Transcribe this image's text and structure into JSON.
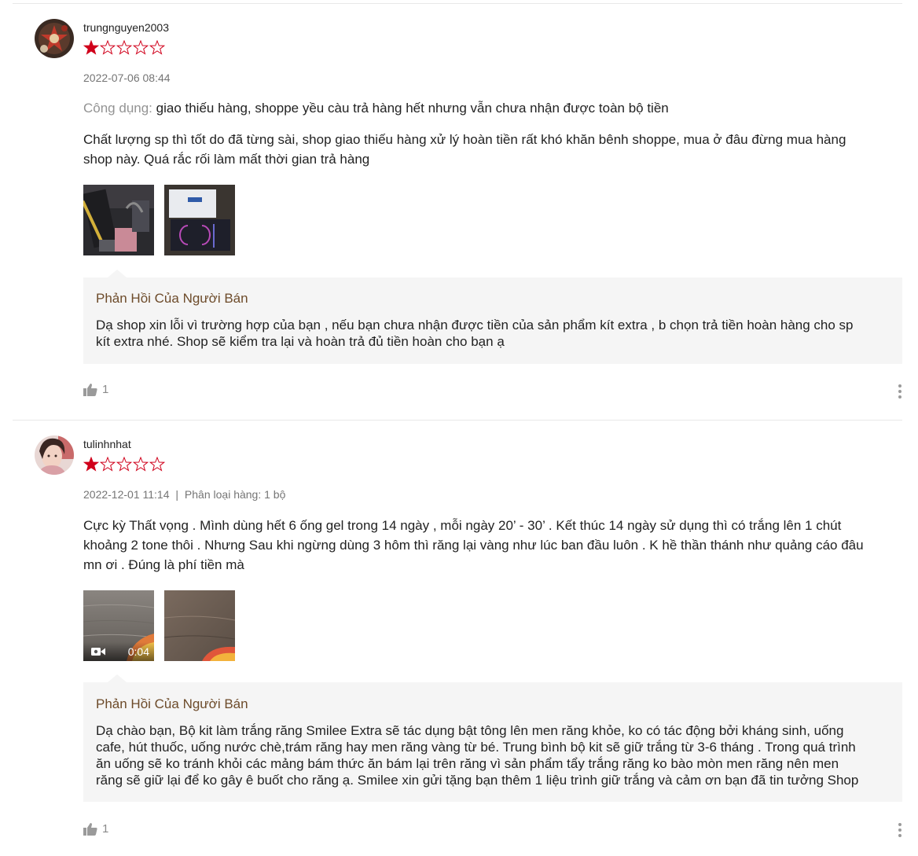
{
  "reviews": [
    {
      "username": "trungnguyen2003",
      "rating": 1,
      "max_rating": 5,
      "datetime": "2022-07-06 08:44",
      "usage_label": "Công dụng:",
      "usage_text": "giao thiếu hàng, shoppe yều càu trả hàng hết nhưng vẫn chưa nhận được toàn bộ tiền",
      "comment_lines": [
        "Chất lượng sp thì tốt do đã từng sài, shop giao thiếu hàng xử lý hoàn tiền rất khó khăn bênh shoppe, mua ở đâu đừng mua hàng",
        "shop này. Quá rắc rối làm mất thời gian trả hàng"
      ],
      "seller_reply_title": "Phản Hồi Của Người Bán",
      "seller_reply_lines": [
        "Dạ shop xin lỗi vì trường hợp của bạn , nếu bạn chưa nhận được tiền của sản phẩm kít extra , b chọn trả tiền hoàn hàng cho sp",
        "kít extra nhé. Shop sẽ kiểm tra lại và hoàn trả đủ tiền hoàn cho bạn ạ"
      ],
      "likes": "1"
    },
    {
      "username": "tulinhnhat",
      "rating": 1,
      "max_rating": 5,
      "datetime": "2022-12-01 11:14",
      "separator": "|",
      "variation": "Phân loại hàng: 1 bộ",
      "comment_lines": [
        "Cực kỳ Thất vọng . Mình dùng hết 6 ống gel trong 14 ngày , mỗi ngày 20’ - 30’ . Kết thúc 14 ngày sử dụng thì có trắng lên 1 chút",
        "khoảng 2 tone thôi . Nhưng Sau khi ngừng dùng 3 hôm thì răng lại vàng như lúc ban đầu luôn . K hề thần thánh như quảng cáo đâu",
        "mn ơi . Đúng là phí tiền mà"
      ],
      "video_duration": "0:04",
      "seller_reply_title": "Phản Hồi Của Người Bán",
      "seller_reply_lines": [
        "Dạ chào bạn, Bộ kit làm trắng răng Smilee Extra sẽ tác dụng bật tông lên men răng khỏe, ko có tác động bởi kháng sinh, uống",
        "cafe, hút thuốc, uống nước chè,trám răng hay men răng vàng từ bé. Trung bình bộ kit sẽ giữ trắng từ 3-6 tháng . Trong quá trình",
        "ăn uống sẽ ko tránh khỏi các mảng bám thức ăn bám lại trên răng vì sản phẩm tẩy trắng răng ko bào mòn men răng nên men",
        "răng sẽ giữ lại để ko gây ê buốt cho răng ạ. Smilee xin gửi tặng bạn thêm 1 liệu trình giữ trắng và cảm ơn bạn đã tin tưởng Shop"
      ],
      "likes": "1"
    }
  ],
  "colors": {
    "star_filled": "#d0011b",
    "reply_bg": "#f5f5f5",
    "reply_title": "#6d4b2a",
    "meta_text": "#757575"
  },
  "icons": {
    "like": "thumbs-up-icon",
    "more": "more-vertical-icon",
    "video": "video-camera-icon",
    "star": "star-icon"
  }
}
